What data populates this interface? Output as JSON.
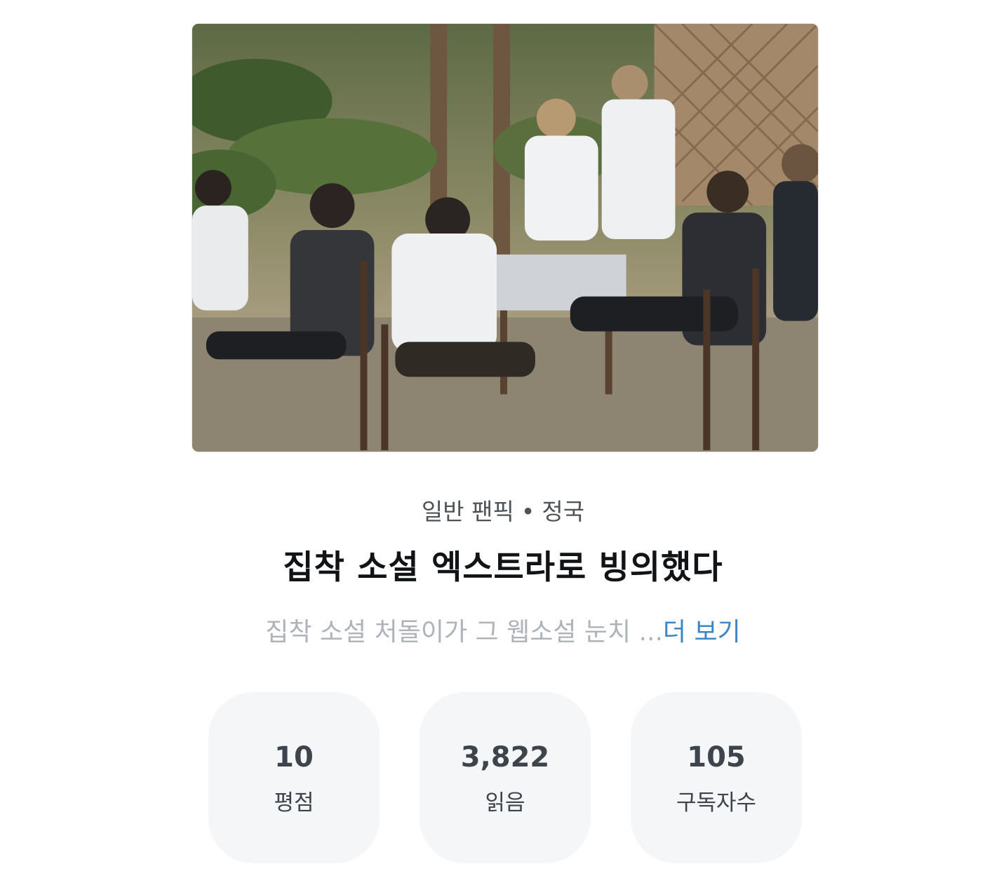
{
  "cover": {
    "alt": "cover-image"
  },
  "meta": {
    "genre": "일반 팬픽",
    "separator": "•",
    "tag": "정국"
  },
  "title": "집착 소설 엑스트라로 빙의했다",
  "synopsis": {
    "text": "집착 소설 처돌이가 그 웹소설 눈치 ...",
    "more_label": "더 보기"
  },
  "stats": [
    {
      "value": "10",
      "label": "평점"
    },
    {
      "value": "3,822",
      "label": "읽음"
    },
    {
      "value": "105",
      "label": "구독자수"
    }
  ],
  "colors": {
    "link": "#3a86c8",
    "stat_bg": "#f5f6f8",
    "title": "#111417"
  }
}
